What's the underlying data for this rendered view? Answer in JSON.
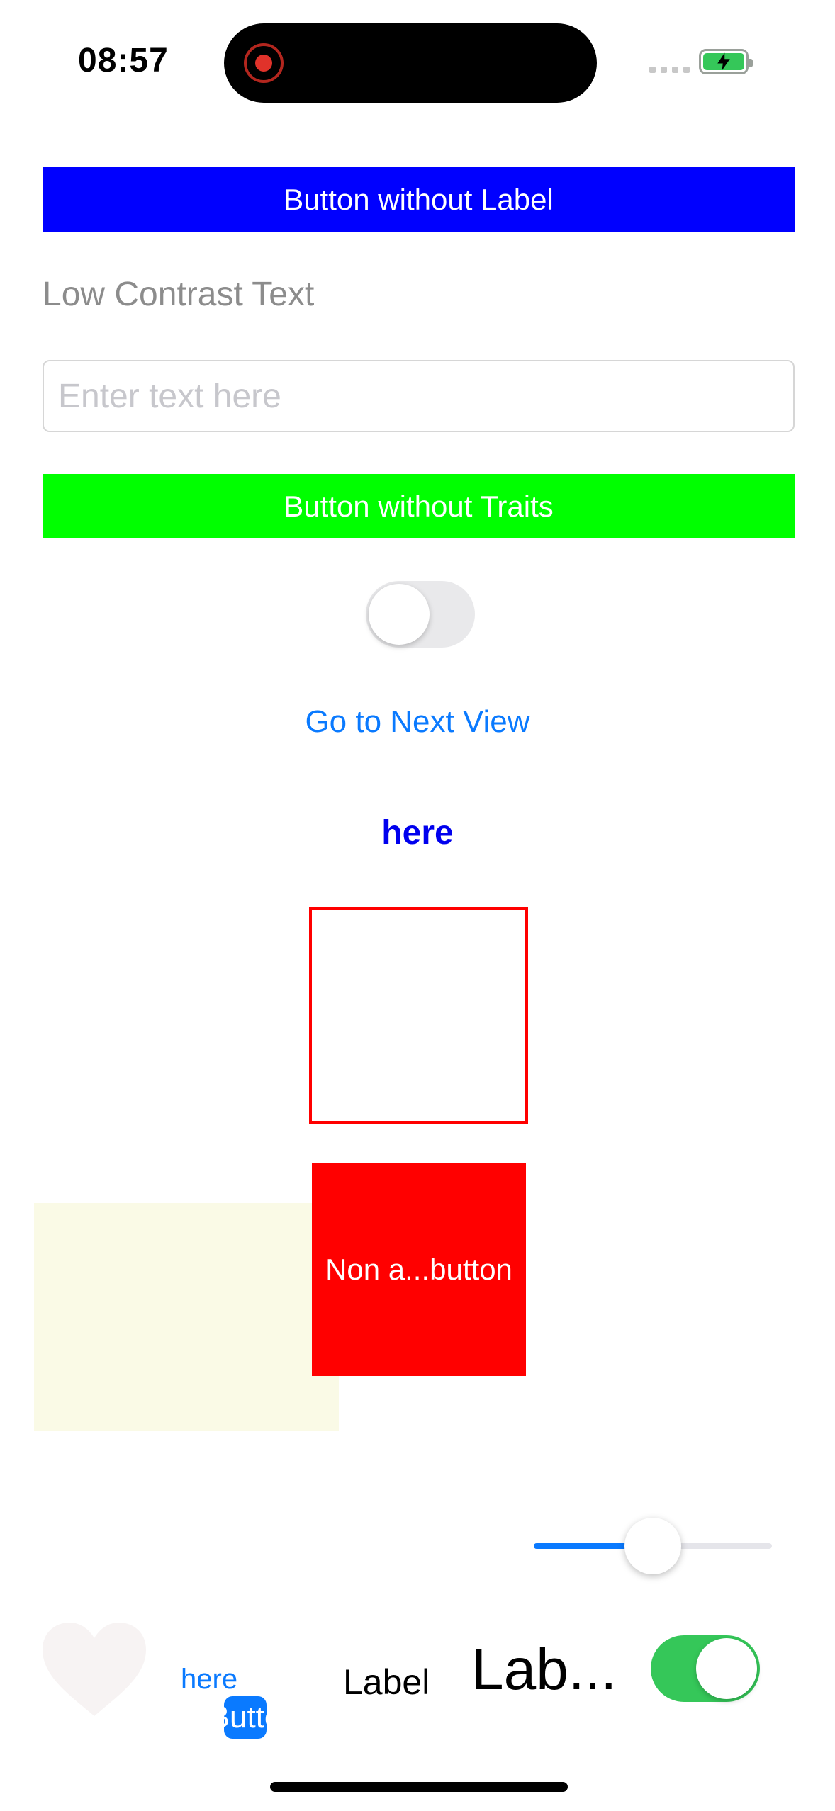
{
  "status_bar": {
    "time": "08:57",
    "icons": [
      "screen-recording-icon",
      "cellular-signal-icon",
      "battery-charging-icon"
    ],
    "battery_color": "#35c759"
  },
  "main": {
    "button_without_label": "Button without Label",
    "low_contrast_text": "Low Contrast Text",
    "text_field": {
      "value": "",
      "placeholder": "Enter text here"
    },
    "button_without_traits": "Button without Traits",
    "toggle_top": {
      "on": false
    },
    "next_view_link": "Go to Next View",
    "here_link": "here",
    "non_accessible_button": "Non a...button",
    "slider": {
      "value": 0.5
    }
  },
  "bottom_row": {
    "icon": "heart-icon",
    "here_text": "here",
    "small_button": "Butto",
    "label_small": "Label",
    "label_large": "Lab...",
    "toggle": {
      "on": true
    }
  },
  "colors": {
    "blue_button": "#0000ff",
    "green_button": "#00ff00",
    "red_button": "#ff0000",
    "accent": "#0a7aff",
    "switch_on": "#35c759"
  }
}
